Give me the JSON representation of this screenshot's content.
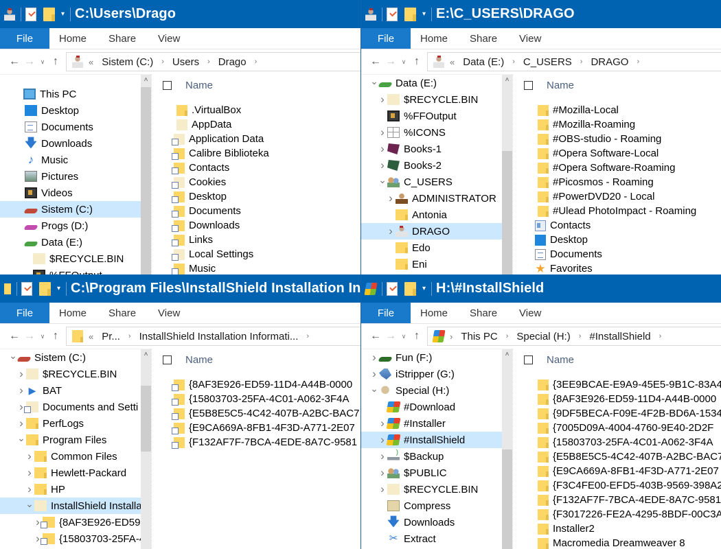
{
  "windows": [
    {
      "title": "C:\\Users\\Drago",
      "title_icon": "user-drago-icon",
      "ribbon_tabs": [
        "File",
        "Home",
        "Share",
        "View"
      ],
      "address": {
        "icon": "user-drago-icon",
        "overflow": "«",
        "crumbs": [
          "Sistem (C:)",
          "Users",
          "Drago"
        ]
      },
      "nav_pane": {
        "scroll_thumb_fraction_start": 0.06,
        "scroll_thumb_fraction_end": 1.0,
        "items": [
          {
            "label": "This PC",
            "icon": "pc-icon",
            "indent": 0,
            "expander": "",
            "selected": false
          },
          {
            "label": "Desktop",
            "icon": "desktop-icon",
            "indent": 1,
            "expander": "",
            "selected": false
          },
          {
            "label": "Documents",
            "icon": "documents-icon",
            "indent": 1,
            "expander": "",
            "selected": false
          },
          {
            "label": "Downloads",
            "icon": "downloads-icon",
            "indent": 1,
            "expander": "",
            "selected": false
          },
          {
            "label": "Music",
            "icon": "music-icon",
            "indent": 1,
            "expander": "",
            "selected": false
          },
          {
            "label": "Pictures",
            "icon": "pictures-icon",
            "indent": 1,
            "expander": "",
            "selected": false
          },
          {
            "label": "Videos",
            "icon": "videos-icon",
            "indent": 1,
            "expander": "",
            "selected": false
          },
          {
            "label": "Sistem (C:)",
            "icon": "drive-red-icon",
            "indent": 1,
            "expander": "",
            "selected": true
          },
          {
            "label": "Progs (D:)",
            "icon": "drive-pink-icon",
            "indent": 1,
            "expander": "",
            "selected": false
          },
          {
            "label": "Data (E:)",
            "icon": "drive-green-icon",
            "indent": 1,
            "expander": "",
            "selected": false
          },
          {
            "label": "$RECYCLE.BIN",
            "icon": "folder-pale-icon",
            "indent": 2,
            "expander": "",
            "selected": false
          },
          {
            "label": "%FFOutput",
            "icon": "film-icon",
            "indent": 2,
            "expander": "",
            "selected": false
          }
        ]
      },
      "content": {
        "column_header": "Name",
        "files": [
          {
            "name": ".VirtualBox",
            "icon": "folder-icon"
          },
          {
            "name": "AppData",
            "icon": "folder-pale-icon"
          },
          {
            "name": "Application Data",
            "icon": "folder-pale-link-icon"
          },
          {
            "name": "Calibre Biblioteka",
            "icon": "folder-link-icon"
          },
          {
            "name": "Contacts",
            "icon": "folder-link-icon"
          },
          {
            "name": "Cookies",
            "icon": "folder-pale-link-icon"
          },
          {
            "name": "Desktop",
            "icon": "folder-link-icon"
          },
          {
            "name": "Documents",
            "icon": "folder-link-icon"
          },
          {
            "name": "Downloads",
            "icon": "folder-link-icon"
          },
          {
            "name": "Links",
            "icon": "folder-link-icon"
          },
          {
            "name": "Local Settings",
            "icon": "folder-pale-link-icon"
          },
          {
            "name": "Music",
            "icon": "folder-link-icon"
          }
        ]
      }
    },
    {
      "title": "E:\\C_USERS\\DRAGO",
      "title_icon": "user-drago-icon",
      "ribbon_tabs": [
        "File",
        "Home",
        "Share",
        "View"
      ],
      "address": {
        "icon": "user-drago-icon",
        "overflow": "«",
        "crumbs": [
          "Data (E:)",
          "C_USERS",
          "DRAGO"
        ]
      },
      "nav_pane": {
        "scroll_thumb_fraction_start": 0.38,
        "scroll_thumb_fraction_end": 1.0,
        "items": [
          {
            "label": "Data (E:)",
            "icon": "drive-green-icon",
            "indent": 0,
            "expander": "v",
            "selected": false
          },
          {
            "label": "$RECYCLE.BIN",
            "icon": "folder-pale-icon",
            "indent": 1,
            "expander": ">",
            "selected": false
          },
          {
            "label": "%FFOutput",
            "icon": "film-icon",
            "indent": 1,
            "expander": "",
            "selected": false
          },
          {
            "label": "%ICONS",
            "icon": "grid-icon",
            "indent": 1,
            "expander": ">",
            "selected": false
          },
          {
            "label": "Books-1",
            "icon": "book-purple-icon",
            "indent": 1,
            "expander": ">",
            "selected": false
          },
          {
            "label": "Books-2",
            "icon": "book-green-icon",
            "indent": 1,
            "expander": ">",
            "selected": false
          },
          {
            "label": "C_USERS",
            "icon": "users-icon",
            "indent": 1,
            "expander": "v",
            "selected": false
          },
          {
            "label": "ADMINISTRATOR",
            "icon": "admin-icon",
            "indent": 2,
            "expander": ">",
            "selected": false
          },
          {
            "label": "Antonia",
            "icon": "folder-icon",
            "indent": 2,
            "expander": "",
            "selected": false
          },
          {
            "label": "DRAGO",
            "icon": "user-drago-icon",
            "indent": 2,
            "expander": ">",
            "selected": true
          },
          {
            "label": "Edo",
            "icon": "folder-icon",
            "indent": 2,
            "expander": "",
            "selected": false
          },
          {
            "label": "Eni",
            "icon": "folder-icon",
            "indent": 2,
            "expander": "",
            "selected": false
          }
        ]
      },
      "content": {
        "column_header": "Name",
        "files": [
          {
            "name": "#Mozilla-Local",
            "icon": "folder-icon"
          },
          {
            "name": "#Mozilla-Roaming",
            "icon": "folder-icon"
          },
          {
            "name": "#OBS-studio - Roaming",
            "icon": "folder-icon"
          },
          {
            "name": "#Opera Software-Local",
            "icon": "folder-icon"
          },
          {
            "name": "#Opera Software-Roaming",
            "icon": "folder-icon"
          },
          {
            "name": "#Picosmos - Roaming",
            "icon": "folder-icon"
          },
          {
            "name": "#PowerDVD20 - Local",
            "icon": "folder-icon"
          },
          {
            "name": "#Ulead PhotoImpact - Roaming",
            "icon": "folder-icon"
          },
          {
            "name": "Contacts",
            "icon": "contacts-icon"
          },
          {
            "name": "Desktop",
            "icon": "desktop-icon"
          },
          {
            "name": "Documents",
            "icon": "documents-icon"
          },
          {
            "name": "Favorites",
            "icon": "star-icon"
          }
        ]
      }
    },
    {
      "title": "C:\\Program Files\\InstallShield Installation Information",
      "title_icon": "folder-small-icon",
      "ribbon_tabs": [
        "File",
        "Home",
        "Share",
        "View"
      ],
      "address": {
        "icon": "folder-icon",
        "overflow": "«",
        "crumbs": [
          "Pr...",
          "InstallShield Installation Informati..."
        ]
      },
      "nav_pane": {
        "scroll_thumb_fraction_start": 0.18,
        "scroll_thumb_fraction_end": 0.51,
        "items": [
          {
            "label": "Sistem (C:)",
            "icon": "drive-red-icon",
            "indent": 0,
            "expander": "v",
            "selected": false
          },
          {
            "label": "$RECYCLE.BIN",
            "icon": "folder-pale-icon",
            "indent": 1,
            "expander": ">",
            "selected": false
          },
          {
            "label": "BAT",
            "icon": "bat-icon",
            "indent": 1,
            "expander": ">",
            "selected": false
          },
          {
            "label": "Documents and Setti",
            "icon": "folder-pale-link-icon",
            "indent": 1,
            "expander": ">",
            "selected": false
          },
          {
            "label": "PerfLogs",
            "icon": "folder-icon",
            "indent": 1,
            "expander": ">",
            "selected": false
          },
          {
            "label": "Program Files",
            "icon": "folder-icon",
            "indent": 1,
            "expander": "v",
            "selected": false
          },
          {
            "label": "Common Files",
            "icon": "folder-icon",
            "indent": 2,
            "expander": ">",
            "selected": false
          },
          {
            "label": "Hewlett-Packard",
            "icon": "folder-icon",
            "indent": 2,
            "expander": ">",
            "selected": false
          },
          {
            "label": "HP",
            "icon": "folder-icon",
            "indent": 2,
            "expander": ">",
            "selected": false
          },
          {
            "label": "InstallShield Installa",
            "icon": "folder-pale-icon",
            "indent": 2,
            "expander": "v",
            "selected": true
          },
          {
            "label": "{8AF3E926-ED59-",
            "icon": "folder-link-icon",
            "indent": 3,
            "expander": ">",
            "selected": false
          },
          {
            "label": "{15803703-25FA-4",
            "icon": "folder-link-icon",
            "indent": 3,
            "expander": ">",
            "selected": false
          }
        ]
      },
      "content": {
        "column_header": "Name",
        "files": [
          {
            "name": "{8AF3E926-ED59-11D4-A44B-0000",
            "icon": "folder-link-icon"
          },
          {
            "name": "{15803703-25FA-4C01-A062-3F4A",
            "icon": "folder-link-icon"
          },
          {
            "name": "{E5B8E5C5-4C42-407B-A2BC-BAC7",
            "icon": "folder-link-icon"
          },
          {
            "name": "{E9CA669A-8FB1-4F3D-A771-2E07",
            "icon": "folder-link-icon"
          },
          {
            "name": "{F132AF7F-7BCA-4EDE-8A7C-9581",
            "icon": "folder-link-icon"
          }
        ]
      }
    },
    {
      "title": "H:\\#InstallShield",
      "title_icon": "windows-logo-icon",
      "ribbon_tabs": [
        "File",
        "Home",
        "Share",
        "View"
      ],
      "address": {
        "icon": "windows-logo-icon",
        "overflow": "›",
        "crumbs": [
          "This PC",
          "Special (H:)",
          "#InstallShield"
        ]
      },
      "nav_pane": {
        "scroll_thumb_fraction_start": 0.5,
        "scroll_thumb_fraction_end": 1.0,
        "items": [
          {
            "label": "Fun (F:)",
            "icon": "drive-dkgreen-icon",
            "indent": 0,
            "expander": ">",
            "selected": false
          },
          {
            "label": "iStripper (G:)",
            "icon": "istripper-icon",
            "indent": 0,
            "expander": ">",
            "selected": false
          },
          {
            "label": "Special (H:)",
            "icon": "skull-icon",
            "indent": 0,
            "expander": "v",
            "selected": false
          },
          {
            "label": "#Download",
            "icon": "windows-logo-icon",
            "indent": 1,
            "expander": "",
            "selected": false
          },
          {
            "label": "#Installer",
            "icon": "windows-logo-icon",
            "indent": 1,
            "expander": ">",
            "selected": false
          },
          {
            "label": "#InstallShield",
            "icon": "windows-logo-icon",
            "indent": 1,
            "expander": ">",
            "selected": true
          },
          {
            "label": "$Backup",
            "icon": "backup-icon",
            "indent": 1,
            "expander": ">",
            "selected": false
          },
          {
            "label": "$PUBLIC",
            "icon": "users-icon",
            "indent": 1,
            "expander": ">",
            "selected": false
          },
          {
            "label": "$RECYCLE.BIN",
            "icon": "folder-pale-icon",
            "indent": 1,
            "expander": ">",
            "selected": false
          },
          {
            "label": "Compress",
            "icon": "compress-icon",
            "indent": 1,
            "expander": "",
            "selected": false
          },
          {
            "label": "Downloads",
            "icon": "downloads-icon",
            "indent": 1,
            "expander": "",
            "selected": false
          },
          {
            "label": "Extract",
            "icon": "scissors-icon",
            "indent": 1,
            "expander": "",
            "selected": false
          }
        ]
      },
      "content": {
        "column_header": "Name",
        "files": [
          {
            "name": "{3EE9BCAE-E9A9-45E5-9B1C-83A4I",
            "icon": "folder-icon"
          },
          {
            "name": "{8AF3E926-ED59-11D4-A44B-0000",
            "icon": "folder-icon"
          },
          {
            "name": "{9DF5BECA-F09E-4F2B-BD6A-1534",
            "icon": "folder-icon"
          },
          {
            "name": "{7005D09A-4004-4760-9E40-2D2F",
            "icon": "folder-icon"
          },
          {
            "name": "{15803703-25FA-4C01-A062-3F4A",
            "icon": "folder-icon"
          },
          {
            "name": "{E5B8E5C5-4C42-407B-A2BC-BAC7",
            "icon": "folder-icon"
          },
          {
            "name": "{E9CA669A-8FB1-4F3D-A771-2E07",
            "icon": "folder-icon"
          },
          {
            "name": "{F3C4FE00-EFD5-403B-9569-398A2",
            "icon": "folder-icon"
          },
          {
            "name": "{F132AF7F-7BCA-4EDE-8A7C-9581",
            "icon": "folder-icon"
          },
          {
            "name": "{F3017226-FE2A-4295-8BDF-00C3A",
            "icon": "folder-icon"
          },
          {
            "name": "Installer2",
            "icon": "folder-icon"
          },
          {
            "name": "Macromedia Dreamweaver 8",
            "icon": "folder-icon"
          }
        ]
      }
    }
  ],
  "colors": {
    "titlebar": "#0063b1",
    "file_tab": "#1979ca",
    "selection": "#cce8ff",
    "folder": "#fcd765"
  }
}
